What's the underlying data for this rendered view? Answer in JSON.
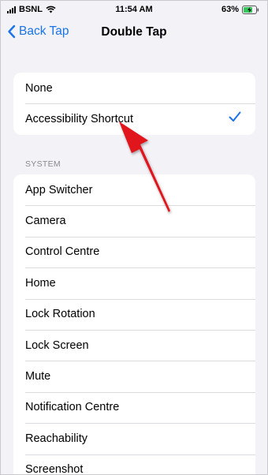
{
  "status_bar": {
    "carrier": "BSNL",
    "time": "11:54 AM",
    "battery": "63%"
  },
  "nav": {
    "back_label": "Back Tap",
    "title": "Double Tap"
  },
  "top_group": {
    "items": [
      {
        "label": "None",
        "selected": false
      },
      {
        "label": "Accessibility Shortcut",
        "selected": true
      }
    ]
  },
  "system_group": {
    "header": "SYSTEM",
    "items": [
      {
        "label": "App Switcher"
      },
      {
        "label": "Camera"
      },
      {
        "label": "Control Centre"
      },
      {
        "label": "Home"
      },
      {
        "label": "Lock Rotation"
      },
      {
        "label": "Lock Screen"
      },
      {
        "label": "Mute"
      },
      {
        "label": "Notification Centre"
      },
      {
        "label": "Reachability"
      },
      {
        "label": "Screenshot"
      }
    ]
  },
  "colors": {
    "accent": "#1a73e8",
    "background": "#f2f2f7",
    "annotation_arrow": "#e0141e"
  },
  "icons": {
    "back": "chevron-left-icon",
    "check": "checkmark-icon",
    "wifi": "wifi-icon",
    "signal": "signal-bars-icon",
    "battery": "battery-charging-icon"
  }
}
